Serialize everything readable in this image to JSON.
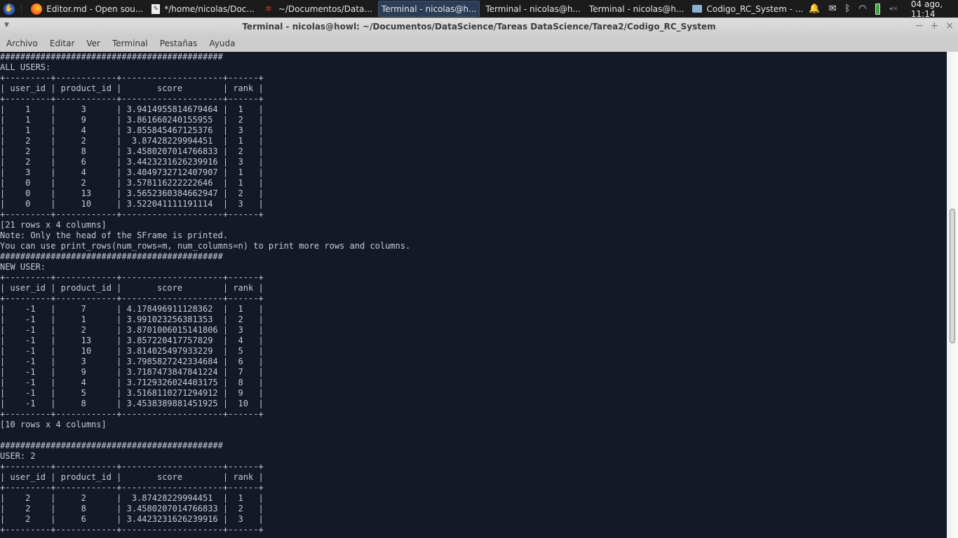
{
  "panel": {
    "tasks": [
      {
        "label": "Editor.md - Open sou...",
        "icon": "firefox-icon",
        "active": false
      },
      {
        "label": "*/home/nicolas/Doc...",
        "icon": "text-editor-icon",
        "active": false
      },
      {
        "label": "~/Documentos/Data...",
        "icon": "app-icon",
        "active": false
      },
      {
        "label": "Terminal - nicolas@h...",
        "icon": "terminal-icon",
        "active": true
      },
      {
        "label": "Terminal - nicolas@h...",
        "icon": "terminal-icon",
        "active": false
      },
      {
        "label": "Terminal - nicolas@h...",
        "icon": "terminal-icon",
        "active": false
      },
      {
        "label": "Codigo_RC_System - ...",
        "icon": "folder-icon",
        "active": false
      }
    ],
    "tray": {
      "bell": "🔔",
      "mail": "✉",
      "bluetooth": "ᛒ",
      "wifi": "◠",
      "volume": "◂×"
    },
    "clock": "04 ago, 11:14"
  },
  "window": {
    "title": "Terminal - nicolas@howl: ~/Documentos/DataScience/Tareas DataScience/Tarea2/Codigo_RC_System",
    "controls": {
      "minimize": "−",
      "maximize": "+",
      "close": "×"
    },
    "menu": [
      "Archivo",
      "Editar",
      "Ver",
      "Terminal",
      "Pestañas",
      "Ayuda"
    ]
  },
  "terminal": {
    "separator": "############################################",
    "border": "+---------+------------+--------------------+------+",
    "header": "| user_id | product_id |       score        | rank |",
    "sections": [
      {
        "heading": "ALL USERS:",
        "rows": [
          "|    1    |     3      | 3.9414955814679464 |  1   |",
          "|    1    |     9      | 3.861660240155955  |  2   |",
          "|    1    |     4      | 3.855845467125376  |  3   |",
          "|    2    |     2      |  3.87428229994451  |  1   |",
          "|    2    |     8      | 3.4580207014766833 |  2   |",
          "|    2    |     6      | 3.4423231626239916 |  3   |",
          "|    3    |     4      | 3.4049732712407907 |  1   |",
          "|    0    |     2      | 3.578116222222646  |  1   |",
          "|    0    |     13     | 3.5652360384662947 |  2   |",
          "|    0    |     10     | 3.522041111191114  |  3   |"
        ],
        "footer": [
          "[21 rows x 4 columns]",
          "Note: Only the head of the SFrame is printed.",
          "You can use print_rows(num_rows=m, num_columns=n) to print more rows and columns."
        ]
      },
      {
        "heading": "NEW USER:",
        "rows": [
          "|    -1   |     7      | 4.178496911128362  |  1   |",
          "|    -1   |     1      | 3.991023256381353  |  2   |",
          "|    -1   |     2      | 3.8701006015141806 |  3   |",
          "|    -1   |     13     | 3.857220417757829  |  4   |",
          "|    -1   |     10     | 3.814025497933229  |  5   |",
          "|    -1   |     3      | 3.7985827242334684 |  6   |",
          "|    -1   |     9      | 3.7187473847841224 |  7   |",
          "|    -1   |     4      | 3.7129326024403175 |  8   |",
          "|    -1   |     5      | 3.5168110271294912 |  9   |",
          "|    -1   |     8      | 3.4538389881451925 |  10  |"
        ],
        "footer": [
          "[10 rows x 4 columns]",
          ""
        ]
      },
      {
        "heading": "USER: 2",
        "rows": [
          "|    2    |     2      |  3.87428229994451  |  1   |",
          "|    2    |     8      | 3.4580207014766833 |  2   |",
          "|    2    |     6      | 3.4423231626239916 |  3   |"
        ],
        "footer": []
      }
    ]
  }
}
